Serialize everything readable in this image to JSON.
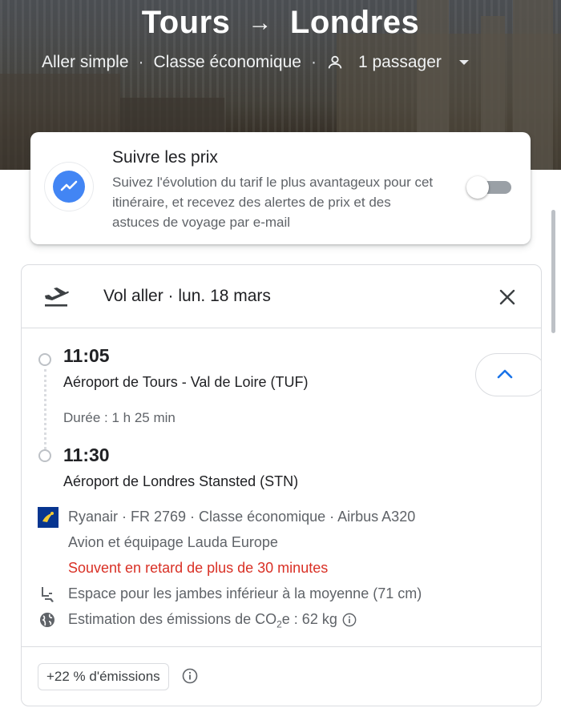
{
  "hero": {
    "origin": "Tours",
    "arrow": "→",
    "destination": "Londres",
    "trip_type": "Aller simple",
    "cabin_class": "Classe économique",
    "passengers": "1 passager"
  },
  "price_tracking": {
    "title": "Suivre les prix",
    "description": "Suivez l'évolution du tarif le plus avantageux pour cet itinéraire, et recevez des alertes de prix et des astuces de voyage par e-mail",
    "toggle_on": false
  },
  "flight": {
    "header_title": "Vol aller · lun. 18 mars",
    "departure_time": "11:05",
    "departure_airport": "Aéroport de Tours - Val de Loire (TUF)",
    "duration": "Durée : 1 h 25 min",
    "arrival_time": "11:30",
    "arrival_airport": "Aéroport de Londres Stansted (STN)",
    "airline_line": "Ryanair · FR 2769 · Classe économique · Airbus A320",
    "operator_line": "Avion et équipage Lauda Europe",
    "delay_warning": "Souvent en retard de plus de 30 minutes",
    "legroom": "Espace pour les jambes inférieur à la moyenne (71 cm)",
    "emissions_prefix": "Estimation des émissions de CO",
    "emissions_sub": "2",
    "emissions_suffix": "e : 62 kg",
    "emissions_chip": "+22 % d'émissions"
  },
  "colors": {
    "accent": "#4285f4",
    "warning": "#d93025",
    "ryanair": "#073590",
    "collapse_arrow": "#1a73e8"
  },
  "icons": [
    "person-icon",
    "dropdown-arrow-icon",
    "price-trend-icon",
    "takeoff-icon",
    "close-icon",
    "chevron-up-icon",
    "ryanair-logo",
    "seat-icon",
    "globe-icon",
    "info-icon"
  ]
}
